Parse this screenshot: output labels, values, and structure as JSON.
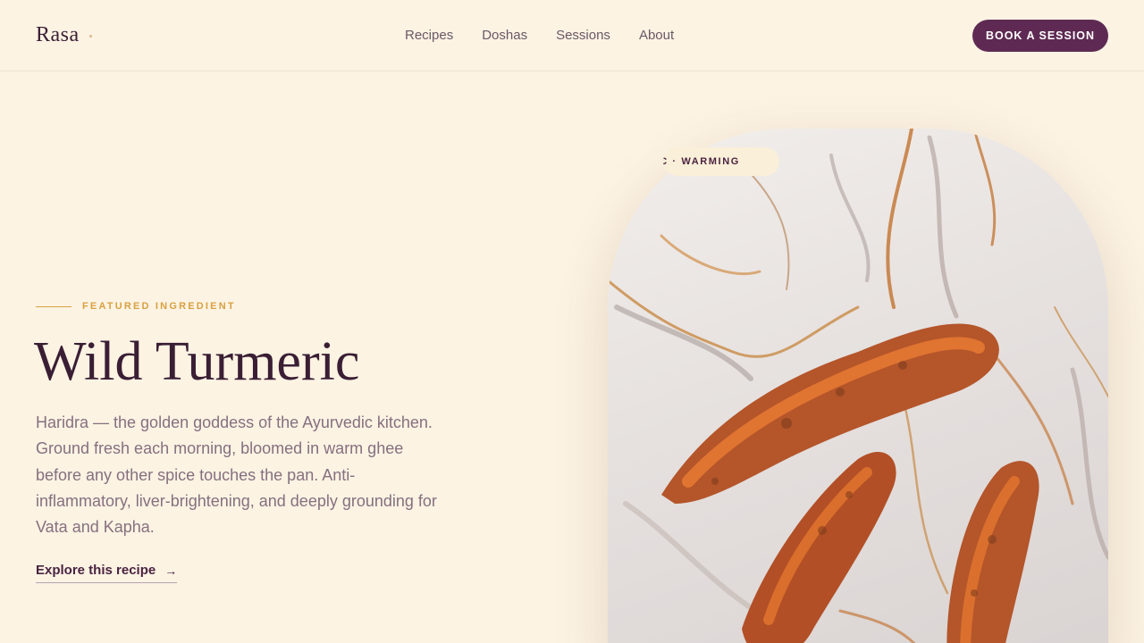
{
  "brand": {
    "name": "Rasa"
  },
  "nav": {
    "items": [
      "Recipes",
      "Doshas",
      "Sessions",
      "About"
    ]
  },
  "header": {
    "cta_label": "BOOK A SESSION"
  },
  "hero": {
    "eyebrow": "FEATURED INGREDIENT",
    "title": "Wild Turmeric",
    "description": "Haridra — the golden goddess of the Ayurvedic kitchen. Ground fresh each morning, bloomed in warm ghee before any other spice touches the pan. Anti-inflammatory, liver-brightening, and deeply grounding for Vata and Kapha.",
    "link_label": "Explore this recipe",
    "link_icon": "arrow-right-icon"
  },
  "photo": {
    "tag": "HIC · WARMING"
  },
  "colors": {
    "background": "#fcf3e3",
    "accent": "#5e2a53",
    "gold": "#d9a040",
    "heading": "#3a1e34"
  }
}
